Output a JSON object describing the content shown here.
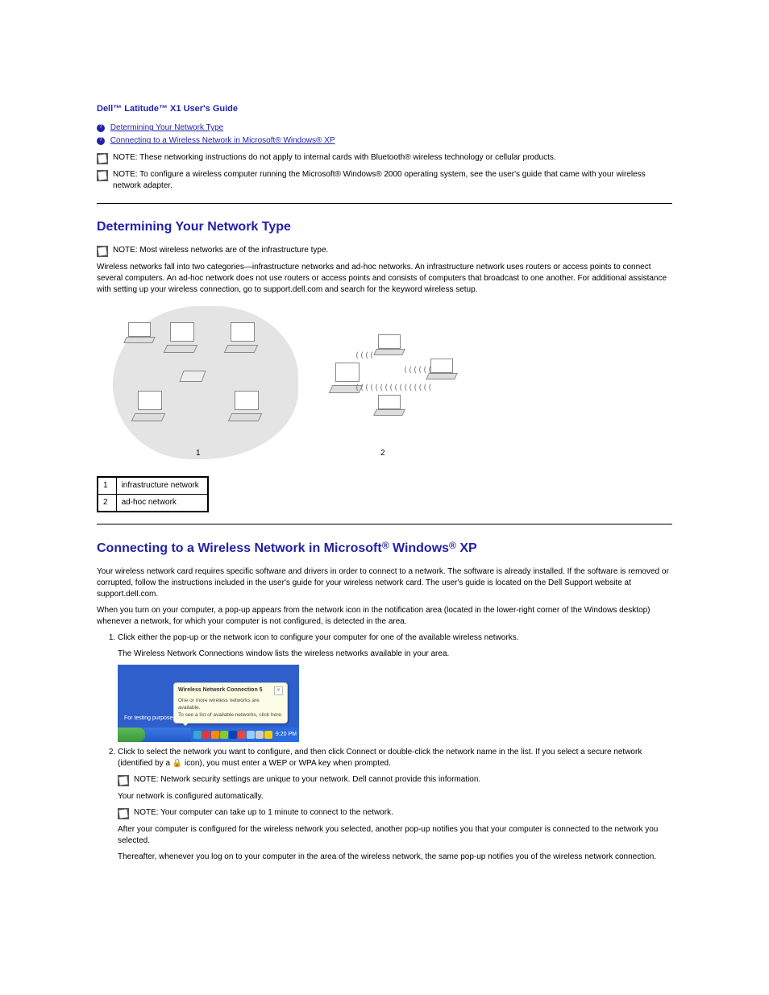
{
  "header": {
    "guide_title": "Dell™ Latitude™ X1 User's Guide",
    "toc": [
      "Determining Your Network Type",
      "Connecting to a Wireless Network in Microsoft® Windows® XP"
    ]
  },
  "notes": {
    "n1": "NOTE: These networking instructions do not apply to internal cards with Bluetooth® wireless technology or cellular products.",
    "n2": "NOTE: To configure a wireless computer running the Microsoft® Windows® 2000 operating system, see the user's guide that came with your wireless network adapter."
  },
  "section1": {
    "title": "Determining Your Network Type",
    "note": "NOTE: Most wireless networks are of the infrastructure type.",
    "para": "Wireless networks fall into two categories—infrastructure networks and ad-hoc networks. An infrastructure network uses routers or access points to connect several computers. An ad-hoc network does not use routers or access points and consists of computers that broadcast to one another. For additional assistance with setting up your wireless connection, go to support.dell.com and search for the keyword wireless setup.",
    "legend": [
      {
        "num": "1",
        "text": "infrastructure network"
      },
      {
        "num": "2",
        "text": "ad-hoc network"
      }
    ],
    "diag": {
      "label1": "1",
      "label2": "2"
    }
  },
  "section2": {
    "title_pre": "Connecting to a Wireless Network in Microsoft",
    "title_mid": " Windows",
    "title_post": " XP",
    "para1": "Your wireless network card requires specific software and drivers in order to connect to a network. The software is already installed. If the software is removed or corrupted, follow the instructions included in the user's guide for your wireless network card. The user's guide is located on the Dell Support website at support.dell.com.",
    "para2": "When you turn on your computer, a pop-up appears from the network icon in the notification area (located in the lower-right corner of the Windows desktop) whenever a network, for which your computer is not configured, is detected in the area.",
    "steps_pre": "1.",
    "step1": "Click either the pop-up or the network icon to configure your computer for one of the available wireless networks.",
    "step1_after": "The Wireless Network Connections window lists the wireless networks available in your area.",
    "step2": "Click to select the network you want to configure, and then click Connect or double-click the network name in the list. If you select a secure network (identified by a 🔒 icon), you must enter a WEP or WPA key when prompted.",
    "step2_note": "NOTE: Network security settings are unique to your network. Dell cannot provide this information.",
    "step2_after": "Your network is configured automatically.",
    "step3_note": "NOTE: Your computer can take up to 1 minute to connect to the network.",
    "step3_after": "After your computer is configured for the wireless network you selected, another pop-up notifies you that your computer is connected to the network you selected.",
    "step3_after2": "Thereafter, whenever you log on to your computer in the area of the wireless network, the same pop-up notifies you of the wireless network connection."
  },
  "shot": {
    "purpose_text": "For testing purposes only…",
    "balloon_title": "Wireless Network Connection 5",
    "balloon_line1": "One or more wireless networks are available.",
    "balloon_line2": "To see a list of available networks, click here.",
    "clock": "9:20 PM"
  }
}
